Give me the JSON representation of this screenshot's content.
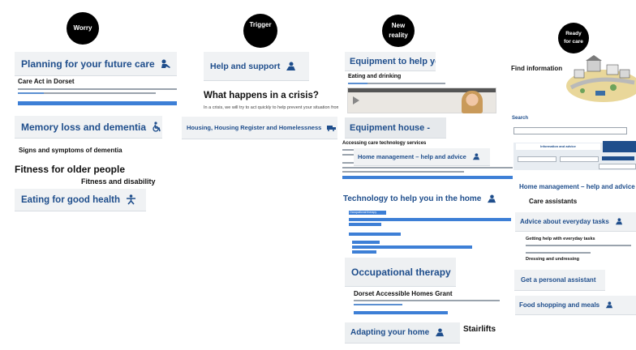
{
  "stages": [
    {
      "line1": "Worry",
      "line2": ""
    },
    {
      "line1": "Trigger",
      "line2": ""
    },
    {
      "line1": "New",
      "line2": "reality"
    },
    {
      "line1": "Ready",
      "line2": "for care"
    }
  ],
  "col1": {
    "planning": "Planning for your future care",
    "care_act": "Care Act in Dorset",
    "memory": "Memory loss and dementia",
    "signs": "Signs and symptoms of dementia",
    "fitness": "Fitness for older people",
    "disability": "Fitness and disability",
    "eating": "Eating for good health"
  },
  "col2": {
    "help_support": "Help and support",
    "crisis": "What happens in a crisis?",
    "crisis_text": "In a crisis, we will try to act quickly to help prevent your situation from gett",
    "housing": "Housing, Housing Register and Homelessness"
  },
  "col3": {
    "equipment": "Equipment to help you",
    "eating_drinking": "Eating and drinking",
    "equipment_house": "Equipment house -",
    "accessing": "Accessing care technology services",
    "home_mgmt": "Home management – help and advice",
    "technology": "Technology to help you in the home",
    "occupational_small": "Occupational therapy",
    "ot": "Occupational therapy",
    "accessible": "Dorset Accessible Homes Grant",
    "adapting": "Adapting your home",
    "stairlifts": "Stairlifts"
  },
  "col4": {
    "find": "Find information",
    "search": "Search",
    "info_tab": "Information and advice",
    "home_mgmt": "Home management – help and advice",
    "care_assistants": "Care assistants",
    "advice_tasks": "Advice about everyday tasks",
    "getting_help": "Getting help with everyday tasks",
    "dressing": "Dressing and undressing",
    "pa": "Get a personal assistant",
    "food": "Food shopping and meals"
  },
  "colors": {
    "accent": "#1f4e8c",
    "highlight": "#3d7fd6",
    "card": "#f0f2f4",
    "stage": "#000000"
  }
}
